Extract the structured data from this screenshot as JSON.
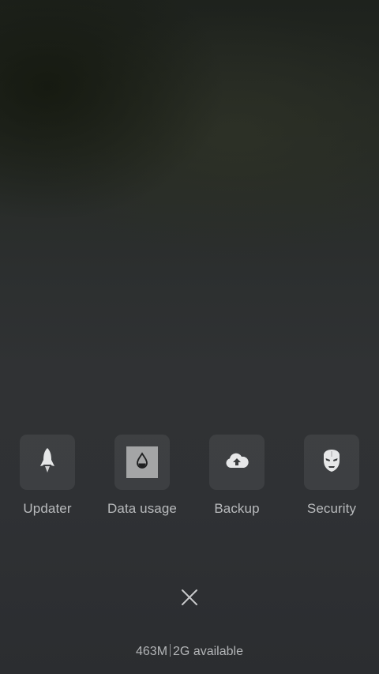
{
  "shortcuts": [
    {
      "id": "updater",
      "label": "Updater",
      "icon": "rocket-icon"
    },
    {
      "id": "data-usage",
      "label": "Data usage",
      "icon": "water-drop-icon"
    },
    {
      "id": "backup",
      "label": "Backup",
      "icon": "cloud-upload-icon"
    },
    {
      "id": "security",
      "label": "Security",
      "icon": "iron-man-mask-icon"
    }
  ],
  "close": {
    "icon": "close-icon"
  },
  "memory": {
    "used": "463M",
    "available": "2G available"
  },
  "colors": {
    "label": "#b9bbbd",
    "icon": "#e2e3e4",
    "tile": "rgba(255,255,255,0.07)"
  }
}
